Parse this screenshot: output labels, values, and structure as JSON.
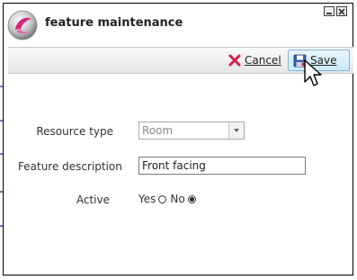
{
  "dialog": {
    "title": "feature maintenance",
    "window_controls": {
      "minimize_icon": "minimize-icon",
      "close_icon": "close-icon"
    }
  },
  "toolbar": {
    "cancel_label": "Cancel",
    "save_label": "Save",
    "cancel_icon": "x-icon",
    "save_icon": "floppy-disk-icon"
  },
  "form": {
    "resource_type": {
      "label": "Resource type",
      "value": "Room"
    },
    "feature_description": {
      "label": "Feature description",
      "value": "Front facing"
    },
    "active": {
      "label": "Active",
      "options": [
        {
          "label": "Yes",
          "checked": false
        },
        {
          "label": "No",
          "checked": true
        }
      ]
    }
  },
  "colors": {
    "accent_pink": "#d02a7a",
    "cancel_red": "#d81e4a",
    "save_highlight": "#cde9f8"
  }
}
